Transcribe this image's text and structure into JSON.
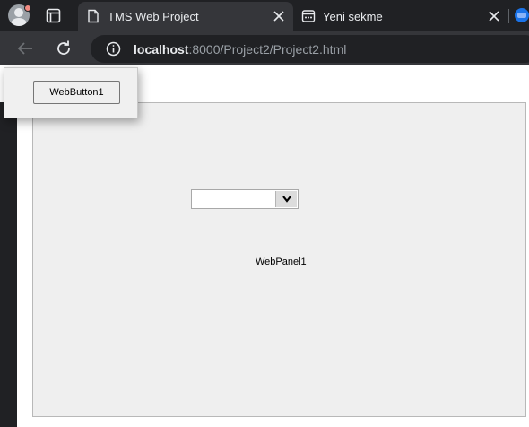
{
  "browser": {
    "tabs": [
      {
        "title": "TMS Web Project",
        "active": true
      },
      {
        "title": "Yeni sekme",
        "active": false
      }
    ],
    "address": {
      "host": "localhost",
      "path": ":8000/Project2/Project2.html"
    }
  },
  "page": {
    "popup": {
      "button_label": "WebButton1"
    },
    "panel": {
      "caption": "WebPanel1",
      "combo_value": ""
    }
  },
  "colors": {
    "chrome_dark": "#202124",
    "chrome_toolbar": "#35363a",
    "panel_bg": "#efefef",
    "page_bg": "#ffffff"
  },
  "icons": {
    "profile": "profile-avatar-icon",
    "tab_search": "tab-search-icon",
    "page": "page-icon",
    "new_tab": "new-tab-page-icon",
    "close": "close-icon",
    "back": "back-arrow-icon",
    "reload": "reload-icon",
    "info": "info-icon",
    "combo_arrow": "chevron-down-icon"
  }
}
